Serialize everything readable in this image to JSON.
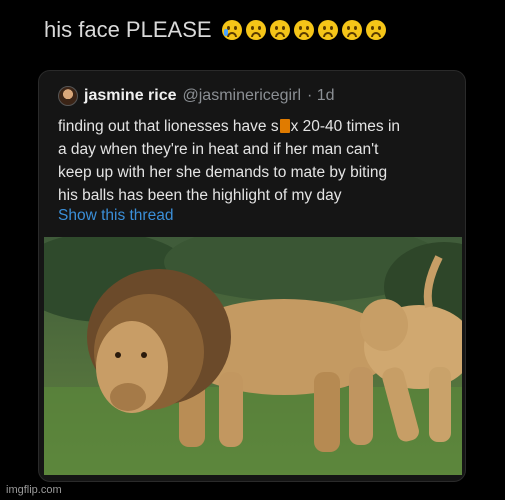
{
  "caption": {
    "text": "his face PLEASE",
    "emojis": [
      "loudly-crying-face-icon",
      "frowning-face-icon",
      "frowning-face-icon",
      "frowning-face-icon",
      "frowning-face-icon",
      "frowning-face-icon",
      "frowning-face-icon"
    ]
  },
  "tweet": {
    "name": "jasmine rice",
    "handle": "@jasminericegirl",
    "time": "· 1d",
    "text_lines": [
      [
        "finding out that lionesses have s",
        "x 20-40 times in"
      ],
      [
        "a day when they're in heat and if her man can't"
      ],
      [
        "keep up with her she demands to mate by biting"
      ],
      [
        "his balls has been the highlight of my day"
      ]
    ],
    "show_thread": "Show this thread"
  },
  "watermark": "imgflip.com",
  "colors": {
    "background": "#000000",
    "card": "#151515",
    "link": "#3b8fd8",
    "censor": "#e07b00"
  }
}
